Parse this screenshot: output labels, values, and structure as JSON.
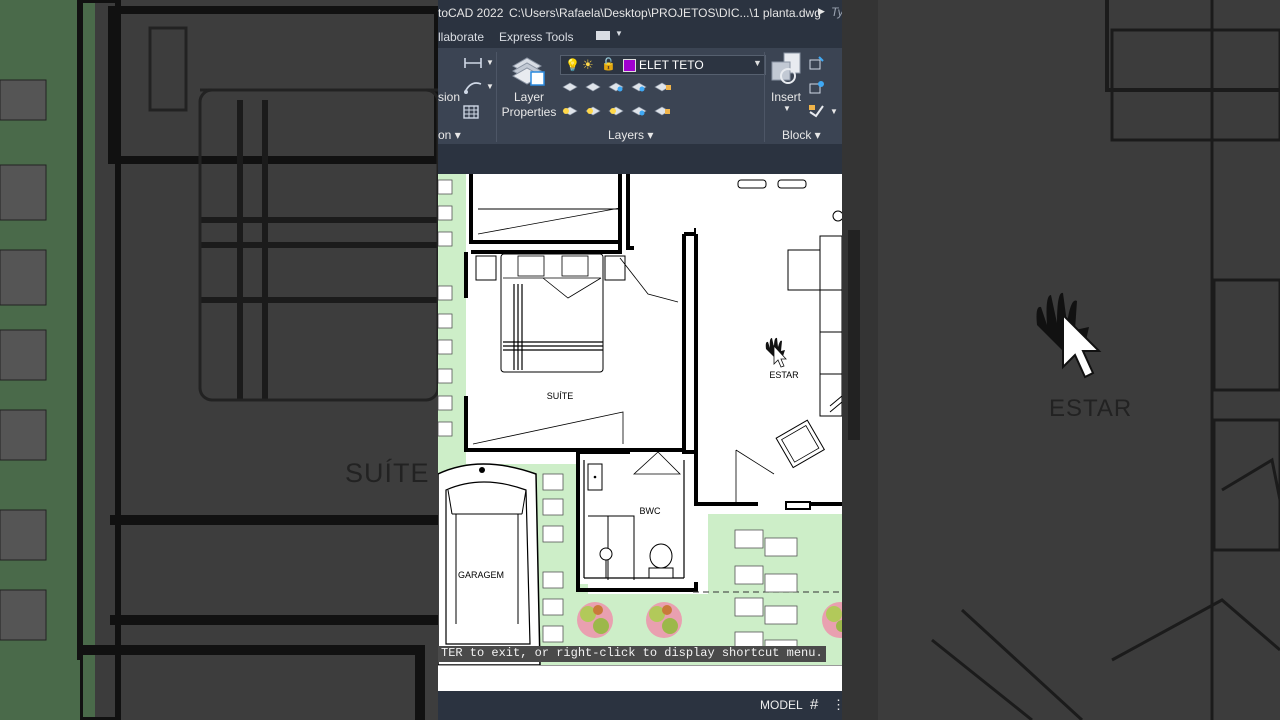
{
  "window": {
    "title_app": "toCAD 2022",
    "title_path": "C:\\Users\\Rafaela\\Desktop\\PROJETOS\\DIC...\\1 planta.dwg",
    "search_hint": "Ty"
  },
  "ribbon_tabs": [
    "llaborate",
    "Express Tools"
  ],
  "ribbon": {
    "annotation_panel_label": "on",
    "dimension_label": "sion",
    "layer_properties_label": "Layer\nProperties",
    "layer_properties_line1": "Layer",
    "layer_properties_line2": "Properties",
    "current_layer": "ELET TETO",
    "current_layer_color": "#a000d0",
    "layers_panel_label": "Layers",
    "insert_label": "Insert",
    "block_panel_label": "Block"
  },
  "drawing": {
    "room_labels": [
      "SUÍTE",
      "ESTAR",
      "BWC",
      "GARAGEM"
    ],
    "cursor": "pan-hand-icon"
  },
  "command_line": {
    "prompt": "TER to exit, or right-click to display shortcut menu.",
    "input": ""
  },
  "status_bar": {
    "space": "MODEL"
  },
  "background": {
    "left_label": "SUÍTE",
    "right_label": "ESTAR"
  },
  "colors": {
    "ribbon_bg": "#3b4453",
    "titlebar_bg": "#2b3340",
    "garden_green": "#cdeec8"
  }
}
